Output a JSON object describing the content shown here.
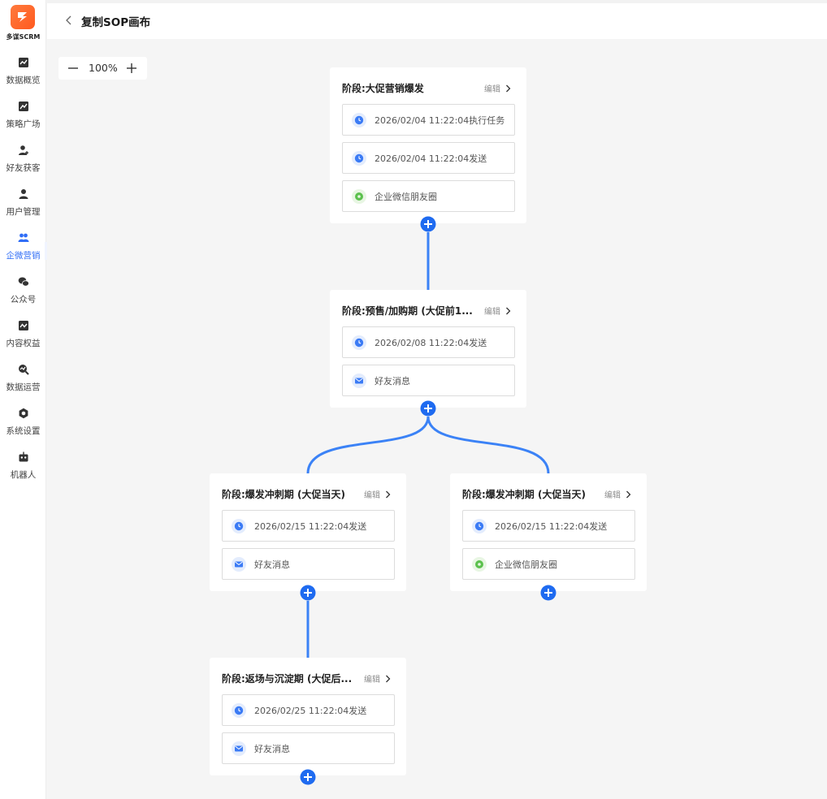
{
  "sidebar": {
    "brand": "多谋SCRM",
    "items": [
      {
        "label": "数据概览",
        "icon": "chart-icon"
      },
      {
        "label": "策略广场",
        "icon": "trend-icon"
      },
      {
        "label": "好友获客",
        "icon": "user-add-icon"
      },
      {
        "label": "用户管理",
        "icon": "user-icon"
      },
      {
        "label": "企微营销",
        "icon": "group-icon",
        "active": true
      },
      {
        "label": "公众号",
        "icon": "wechat-icon"
      },
      {
        "label": "内容权益",
        "icon": "content-icon"
      },
      {
        "label": "数据运营",
        "icon": "search-chart-icon"
      },
      {
        "label": "系统设置",
        "icon": "gear-icon"
      },
      {
        "label": "机器人",
        "icon": "robot-icon"
      }
    ]
  },
  "header": {
    "title": "复制SOP画布"
  },
  "zoom": {
    "value": "100%"
  },
  "colors": {
    "accent": "#2f6df6",
    "edge": "#3b82f6",
    "clock": "#3b7bf5",
    "moments": "#5cc14e"
  },
  "edit_label": "编辑",
  "nodes": [
    {
      "title": "阶段:大促营销爆发",
      "rows": [
        {
          "icon": "clock-icon",
          "text": "2026/02/04 11:22:04执行任务"
        },
        {
          "icon": "clock-icon",
          "text": "2026/02/04 11:22:04发送"
        },
        {
          "icon": "moments-icon",
          "text": "企业微信朋友圈"
        }
      ]
    },
    {
      "title": "阶段:预售/加购期 (大促前1...",
      "rows": [
        {
          "icon": "clock-icon",
          "text": "2026/02/08 11:22:04发送"
        },
        {
          "icon": "mail-icon",
          "text": "好友消息"
        }
      ]
    },
    {
      "title": "阶段:爆发冲刺期 (大促当天)",
      "rows": [
        {
          "icon": "clock-icon",
          "text": "2026/02/15 11:22:04发送"
        },
        {
          "icon": "mail-icon",
          "text": "好友消息"
        }
      ]
    },
    {
      "title": "阶段:爆发冲刺期 (大促当天)",
      "rows": [
        {
          "icon": "clock-icon",
          "text": "2026/02/15 11:22:04发送"
        },
        {
          "icon": "moments-icon",
          "text": "企业微信朋友圈"
        }
      ]
    },
    {
      "title": "阶段:返场与沉淀期 (大促后...",
      "rows": [
        {
          "icon": "clock-icon",
          "text": "2026/02/25 11:22:04发送"
        },
        {
          "icon": "mail-icon",
          "text": "好友消息"
        }
      ]
    }
  ]
}
